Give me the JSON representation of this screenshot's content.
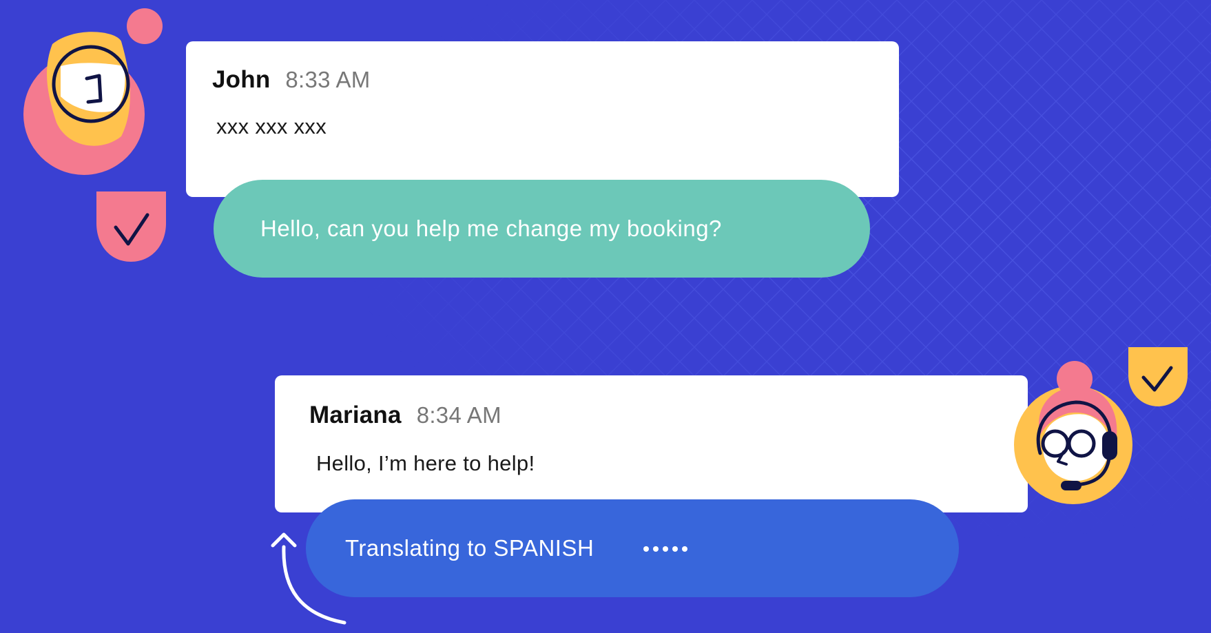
{
  "conversation": {
    "incoming": {
      "sender": "John",
      "time": "8:33 AM",
      "message": "xxx xxx xxx",
      "translation": "Hello, can you help me change my booking?"
    },
    "outgoing": {
      "sender": "Mariana",
      "time": "8:34 AM",
      "message": "Hello, I’m here to help!",
      "status": "Translating to SPANISH"
    }
  },
  "icons": {
    "user_avatar": "customer-avatar-icon",
    "agent_avatar": "agent-avatar-with-headset-icon",
    "checkmark": "checkmark-icon",
    "typing": "typing-dots-icon",
    "arrow": "curved-arrow-up-icon"
  },
  "colors": {
    "background": "#3a40d2",
    "card": "#ffffff",
    "translation_bubble": "#6cc8b8",
    "status_bubble": "#3866db",
    "accent_pink": "#f47a8f",
    "accent_yellow": "#ffc24d",
    "outline_navy": "#101445"
  }
}
